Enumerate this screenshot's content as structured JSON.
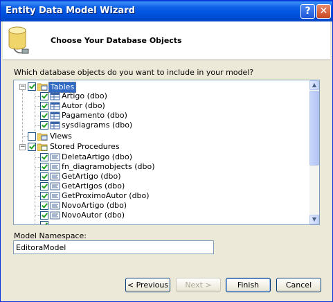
{
  "window": {
    "title": "Entity Data Model Wizard",
    "help_glyph": "?",
    "close_glyph": "✕"
  },
  "header": {
    "title": "Choose Your Database Objects",
    "icon": "database-icon"
  },
  "question": "Which database objects do you want to include in your model?",
  "tree": {
    "tables": {
      "label": "Tables",
      "checked": true,
      "expanded": true,
      "items": [
        "Artigo (dbo)",
        "Autor (dbo)",
        "Pagamento (dbo)",
        "sysdiagrams (dbo)"
      ]
    },
    "views": {
      "label": "Views",
      "checked": false,
      "expanded": false
    },
    "stored_procedures": {
      "label": "Stored Procedures",
      "checked": true,
      "expanded": true,
      "items": [
        "DeletaArtigo (dbo)",
        "fn_diagramobjects (dbo)",
        "GetArtigo (dbo)",
        "GetArtigos (dbo)",
        "GetProximoAutor (dbo)",
        "NovoArtigo (dbo)",
        "NovoAutor (dbo)"
      ]
    }
  },
  "namespace": {
    "label": "Model Namespace:",
    "value": "EditoraModel"
  },
  "buttons": {
    "previous": "< Previous",
    "next": "Next >",
    "finish": "Finish",
    "cancel": "Cancel"
  },
  "colors": {
    "titlebar": "#0054e3",
    "selection": "#316ac5",
    "check": "#21a121",
    "dialog": "#ece9d8"
  }
}
